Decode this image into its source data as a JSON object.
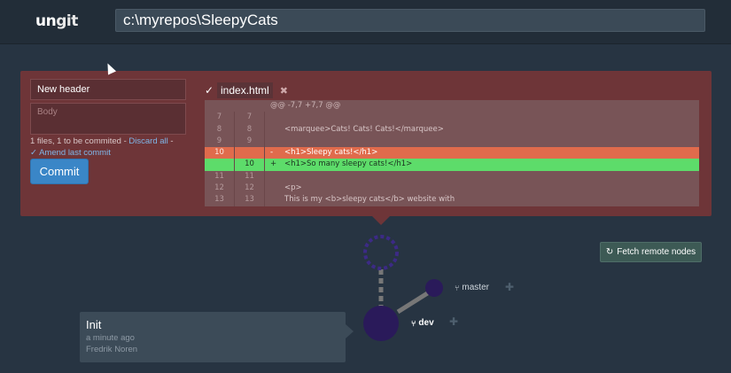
{
  "header": {
    "logo_main": "un",
    "logo_accent": "git",
    "repo_path": "c:\\myrepos\\SleepyCats"
  },
  "commit_panel": {
    "header_value": "New header",
    "body_placeholder": "Body",
    "files_text": "1 files, 1 to be commited - ",
    "discard_link": "Discard all",
    "discard_suffix": " -",
    "amend_label": "✓ Amend last commit",
    "commit_button": "Commit"
  },
  "diff": {
    "check_icon": "✓",
    "file_name": "index.html",
    "close_icon": "✖",
    "hunk_header": "@@ -7,7 +7,7 @@",
    "rows": [
      {
        "type": "context",
        "old": "7",
        "new": "7",
        "sign": "",
        "code": ""
      },
      {
        "type": "context",
        "old": "8",
        "new": "8",
        "sign": "",
        "code": "<marquee>Cats! Cats! Cats!</marquee>"
      },
      {
        "type": "context",
        "old": "9",
        "new": "9",
        "sign": "",
        "code": ""
      },
      {
        "type": "removed",
        "old": "10",
        "new": "",
        "sign": "-",
        "code": "<h1>Sleepy cats!</h1>"
      },
      {
        "type": "added",
        "old": "",
        "new": "10",
        "sign": "+",
        "code": "<h1>So many sleepy cats!</h1>"
      },
      {
        "type": "context",
        "old": "11",
        "new": "11",
        "sign": "",
        "code": ""
      },
      {
        "type": "context",
        "old": "12",
        "new": "12",
        "sign": "",
        "code": "<p>"
      },
      {
        "type": "context",
        "old": "13",
        "new": "13",
        "sign": "",
        "code": "      This is my <b>sleepy cats</b> website with"
      }
    ]
  },
  "graph": {
    "fetch_button": "Fetch remote nodes",
    "refresh_icon": "↻",
    "branch_icon": "⑂",
    "branches": {
      "master": "master",
      "dev": "dev"
    },
    "plus_icon": "✚",
    "commit": {
      "title": "Init",
      "time": "a minute ago",
      "author": "Fredrik Noren"
    },
    "colors": {
      "node": "#2a1a5a",
      "pending_node": "#3c2a86",
      "edge": "#777777"
    }
  }
}
